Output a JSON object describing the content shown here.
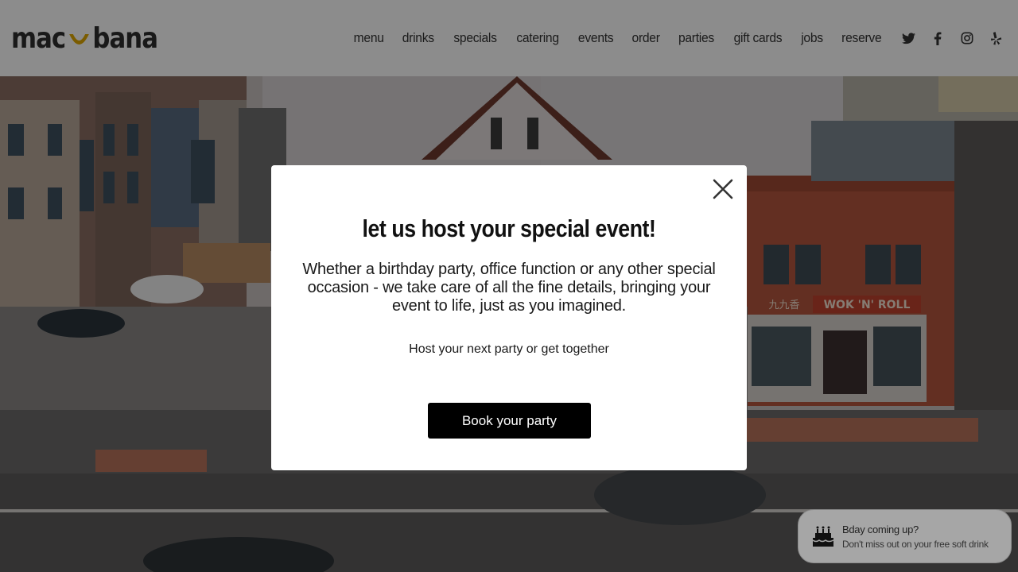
{
  "brand": {
    "logo_left": "mac",
    "logo_right": "bana",
    "accent": "#e0a800"
  },
  "nav": {
    "items": [
      "menu",
      "drinks",
      "specials",
      "catering",
      "events",
      "order",
      "parties",
      "gift cards",
      "jobs",
      "reserve"
    ],
    "social": [
      "twitter-icon",
      "facebook-icon",
      "instagram-icon",
      "yelp-icon"
    ]
  },
  "hero": {
    "sign_text": "WOK 'N' ROLL",
    "sign_chinese": "九九香"
  },
  "modal": {
    "title": "let us host your special event!",
    "body": "Whether a birthday party, office function or any other special occasion - we take care of all the fine details, bringing your event to life, just as you imagined.",
    "subtitle": "Host your next party or get together",
    "button_label": "Book your party"
  },
  "toast": {
    "title": "Bday coming up?",
    "message": "Don't miss out on your free soft drink"
  }
}
